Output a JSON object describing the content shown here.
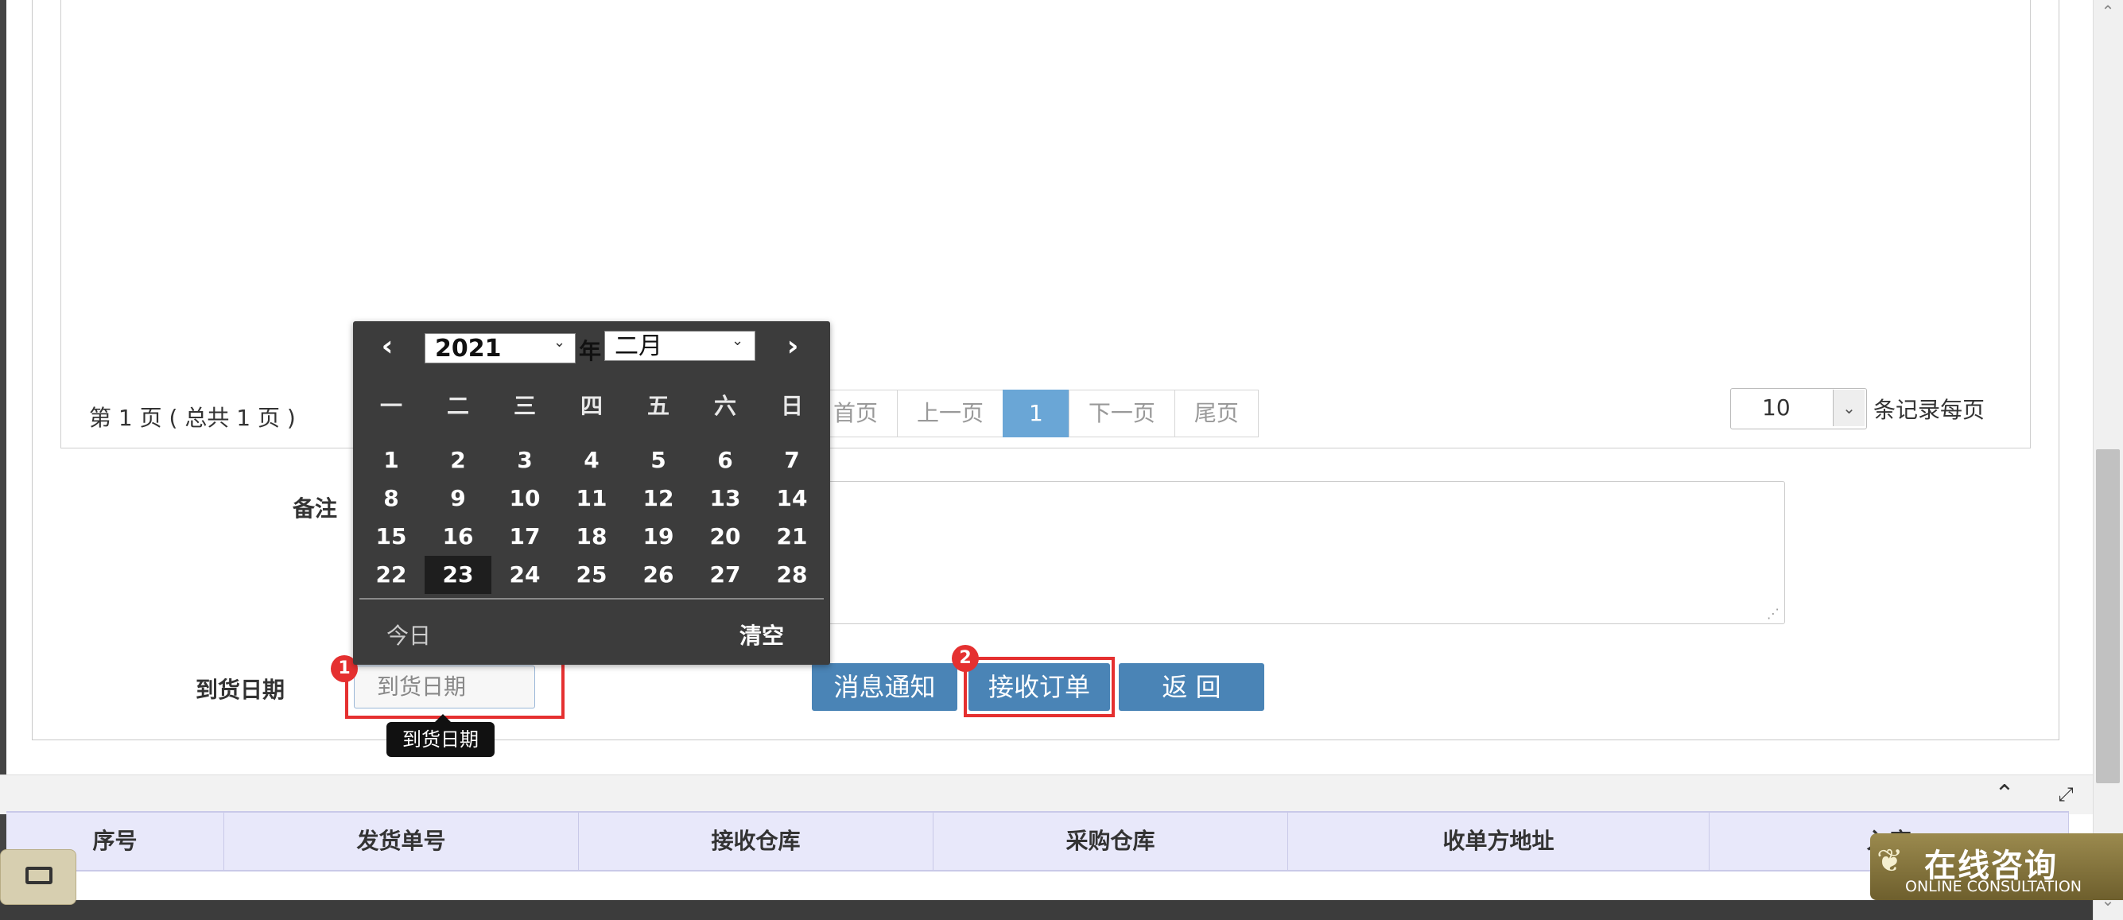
{
  "pagination": {
    "info": "第 1 页 ( 总共 1 页 )",
    "first": "首页",
    "prev": "上一页",
    "current": "1",
    "next": "下一页",
    "last": "尾页",
    "page_size": "10",
    "page_size_label": "条记录每页"
  },
  "form": {
    "remark_label": "备注",
    "remark_value": "",
    "date_label": "到货日期",
    "date_placeholder": "到货日期",
    "date_tooltip": "到货日期"
  },
  "buttons": {
    "notify": "消息通知",
    "receive": "接收订单",
    "back": "返 回"
  },
  "annotations": {
    "badge_1": "1",
    "badge_2": "2"
  },
  "calendar": {
    "year": "2021",
    "year_suffix": "年",
    "month": "二月",
    "weekdays": [
      "一",
      "二",
      "三",
      "四",
      "五",
      "六",
      "日"
    ],
    "weeks": [
      [
        "1",
        "2",
        "3",
        "4",
        "5",
        "6",
        "7"
      ],
      [
        "8",
        "9",
        "10",
        "11",
        "12",
        "13",
        "14"
      ],
      [
        "15",
        "16",
        "17",
        "18",
        "19",
        "20",
        "21"
      ],
      [
        "22",
        "23",
        "24",
        "25",
        "26",
        "27",
        "28"
      ]
    ],
    "selected_day": "23",
    "today_label": "今日",
    "clear_label": "清空"
  },
  "grid": {
    "columns": [
      "序号",
      "发货单号",
      "接收仓库",
      "采购仓库",
      "收单方地址",
      "入库"
    ]
  },
  "consult": {
    "title": "在线咨询",
    "subtitle": "ONLINE CONSULTATION"
  },
  "icons": {
    "prev_month": "chevron-left-icon",
    "next_month": "chevron-right-icon",
    "collapse": "chevron-up-icon",
    "expand": "expand-arrows-icon",
    "restore": "window-restore-icon"
  },
  "colors": {
    "primary_button": "#4a84b6",
    "active_page": "#6aa6d6",
    "annotation_red": "#e53030",
    "calendar_bg": "#3c3c3c",
    "grid_header_bg": "#e8e8fa"
  }
}
